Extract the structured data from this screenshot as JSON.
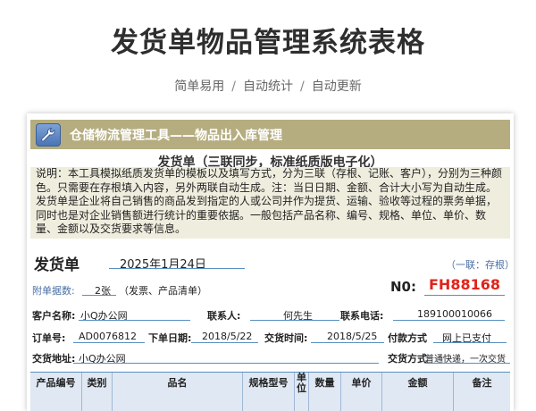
{
  "page": {
    "title": "发货单物品管理系统表格",
    "tags": [
      "简单易用",
      "自动统计",
      "自动更新"
    ],
    "separator": "/"
  },
  "toolbar": {
    "icon": "wrench-icon",
    "title": "仓储物流管理工具——物品出入库管理"
  },
  "document": {
    "heading": "发货单（三联同步，标准纸质版电子化）",
    "description": "说明：本工具模拟纸质发货单的模板以及填写方式，分为三联（存根、记账、客户），分别为三种颜色。只需要在存根填入内容，另外两联自动生成。注：当日日期、金额、合计大小写为自动生成。发货单是企业将自己销售的商品发到指定的人或公司并作为提货、运输、验收等过程的票务单据，同时也是对企业销售额进行统计的重要依据。一般包括产品名称、编号、规格、单位、单价、数量、金额以及交货要求等信息。"
  },
  "form": {
    "label": "发货单",
    "date": "2025年1月24日",
    "copy_note": "（一联：存根）",
    "attach_label": "附单据数:",
    "attach_count": "2张",
    "attach_note": "（发票、产品清单）",
    "no_label": "N0:",
    "no_value": "FH88168",
    "customer_name_label": "客户名称:",
    "customer_name": "小Q办公网",
    "contact_label": "联系人:",
    "contact": "何先生",
    "phone_label": "联系电话:",
    "phone": "189100010066",
    "order_no_label": "订单号:",
    "order_no": "AD0076812",
    "order_date_label": "下单日期:",
    "order_date": "2018/5/22",
    "delivery_time_label": "交货时间:",
    "delivery_time": "2018/5/25",
    "payment_label": "付款方式",
    "payment": "网上已支付",
    "address_label": "交货地址:",
    "address": "小Q办公网",
    "delivery_method_label": "交货方式",
    "delivery_method": "普通快递，一次交货"
  },
  "table": {
    "headers": [
      "产品编号",
      "类别",
      "品名",
      "规格型号",
      "单位",
      "数量",
      "单价",
      "金额",
      "备注"
    ]
  }
}
